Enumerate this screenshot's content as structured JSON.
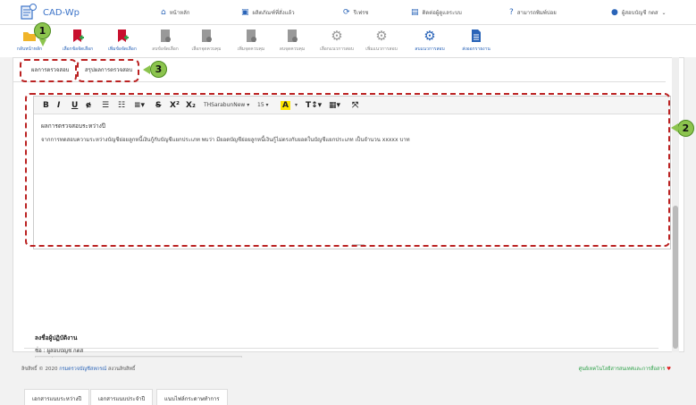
{
  "app": {
    "name": "CAD-Wp"
  },
  "nav": [
    {
      "label": "หน้าหลัก",
      "icon": "home-icon"
    },
    {
      "label": "ผลิตภัณฑ์ที่สั่งแล้ว",
      "icon": "box-icon"
    },
    {
      "label": "รีเฟรช",
      "icon": "refresh-icon"
    },
    {
      "label": "ติดต่อผู้ดูแลระบบ",
      "icon": "contact-icon"
    },
    {
      "label": "สามารถพิมพ์บ่อย",
      "icon": "help-icon"
    }
  ],
  "user": {
    "label": "ผู้สอบบัญชี กตส"
  },
  "toolbar": [
    {
      "label": "กลับหน้าหลัก",
      "icon": "folder-icon",
      "active": true
    },
    {
      "label": "เลือกข้อจัดเลือก",
      "icon": "bookmark-add-icon",
      "active": true
    },
    {
      "label": "เพิ่มข้อจัดเลือก",
      "icon": "bookmark-add-icon",
      "active": true
    },
    {
      "label": "ลบข้อจัดเลือก",
      "icon": "document-icon",
      "active": false
    },
    {
      "label": "เลือกจุดควบคุม",
      "icon": "document-icon",
      "active": false
    },
    {
      "label": "เพิ่มจุดควบคุม",
      "icon": "document-icon",
      "active": false
    },
    {
      "label": "ลบจุดควบคุม",
      "icon": "document-icon",
      "active": false
    },
    {
      "label": "เลือกแนวการสอบ",
      "icon": "gear-icon",
      "active": false
    },
    {
      "label": "เพิ่มแนวการสอบ",
      "icon": "gear-icon",
      "active": false
    },
    {
      "label": "ลบแนวการสอบ",
      "icon": "gear-icon",
      "active": true
    },
    {
      "label": "ส่งออกรายงาน",
      "icon": "export-icon",
      "active": true
    }
  ],
  "tabs": [
    {
      "label": "ผลการตรวจสอบ"
    },
    {
      "label": "สรุปผลการตรวจสอบ"
    }
  ],
  "editor": {
    "font": "THSarabunNew",
    "size": "15",
    "title": "ผลการตรวจสอบระหว่างปี",
    "body": "จากการทดสอบความระหว่างบัญชีย่อยลูกหนี้เงินกู้กับบัญชีแยกประเภท พบว่า มียอดบัญชีย่อยลูกหนี้เงินกู้ไม่ตรงกับยอดในบัญชีแยกประเภท เป็นจำนวน xxxxx บาท"
  },
  "badges": [
    "1",
    "2",
    "3"
  ],
  "signature": {
    "title": "ลงชื่อผู้ปฏิบัติงาน",
    "name": "ชื่อ : ผู้สอบบัญชี กตส"
  },
  "bottom_tabs": [
    "เอกสารแนบระหว่างปี",
    "เอกสารแนบประจำปี",
    "แนบไฟล์กระดาษทำการ"
  ],
  "footer": {
    "left_prefix": "ลิขสิทธิ์ © 2020",
    "left_link": "กรมตรวจบัญชีสหกรณ์",
    "left_suffix": "สงวนลิขสิทธิ์",
    "right": "ศูนย์เทคโนโลยีสารสนเทศและการสื่อสาร"
  },
  "colors": {
    "accent": "#2a64b8",
    "annotation": "#b22222",
    "badge": "#8cc44e"
  }
}
